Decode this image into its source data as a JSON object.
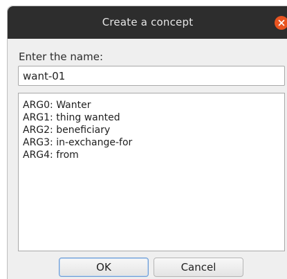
{
  "window": {
    "title": "Create a concept",
    "close_icon": "close-icon",
    "close_color": "#e95420"
  },
  "form": {
    "name_label": "Enter the name:",
    "name_value": "want-01",
    "args": [
      "ARG0: Wanter",
      "ARG1: thing wanted",
      "ARG2: beneficiary",
      "ARG3: in-exchange-for",
      "ARG4: from"
    ]
  },
  "buttons": {
    "ok_label": "OK",
    "cancel_label": "Cancel"
  }
}
